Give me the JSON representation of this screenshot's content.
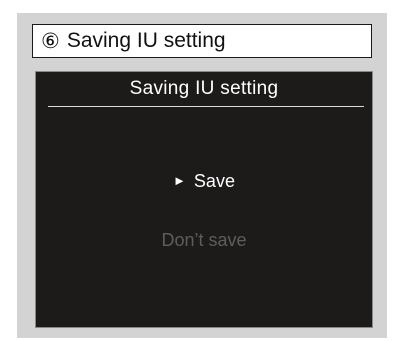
{
  "title_box": {
    "step_marker": "⑥",
    "title": "Saving IU setting"
  },
  "screen": {
    "header": "Saving IU setting",
    "options": [
      {
        "cursor": "►",
        "label": "Save",
        "selected": true
      },
      {
        "label": "Don’t save",
        "selected": false
      }
    ]
  },
  "colors": {
    "screen_background": "#1d1a1a",
    "selected_text": "#ffffff",
    "unselected_text": "#5e5c5c",
    "frame_background": "#d3d3d3"
  }
}
